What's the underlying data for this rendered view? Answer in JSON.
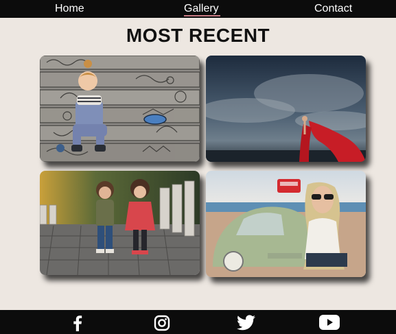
{
  "nav": {
    "home_label": "Home",
    "gallery_label": "Gallery",
    "contact_label": "Contact",
    "active": "Gallery"
  },
  "main": {
    "title": "MOST RECENT"
  },
  "gallery": {
    "photos": [
      {
        "name": "girl-on-mosaic-steps"
      },
      {
        "name": "woman-red-dress-stormy-sky"
      },
      {
        "name": "two-children-stone-path"
      },
      {
        "name": "woman-sunglasses-vintage-car"
      }
    ]
  },
  "footer": {
    "icons": [
      "facebook-icon",
      "instagram-icon",
      "twitter-icon",
      "youtube-icon"
    ]
  },
  "colors": {
    "background": "#ede7e1",
    "nav_bg": "#0c0c0c",
    "active_underline": "#c97b84"
  }
}
